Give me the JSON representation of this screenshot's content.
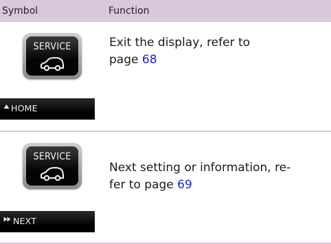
{
  "header": {
    "symbol_label": "Symbol",
    "function_label": "Function"
  },
  "rows": [
    {
      "button_label": "SERVICE",
      "bar_label": "HOME",
      "bar_icon": "triangle-up-icon",
      "function_line1": "Exit the display, refer to",
      "function_prefix": "page ",
      "page_ref": "68"
    },
    {
      "button_label": "SERVICE",
      "bar_label": "NEXT",
      "bar_icon": "double-arrow-right-icon",
      "function_line1": "Next setting or information, re-",
      "function_prefix": "fer to page ",
      "page_ref": "69"
    }
  ],
  "colors": {
    "header_bg": "#d9c7dd",
    "link": "#1a22d6"
  }
}
